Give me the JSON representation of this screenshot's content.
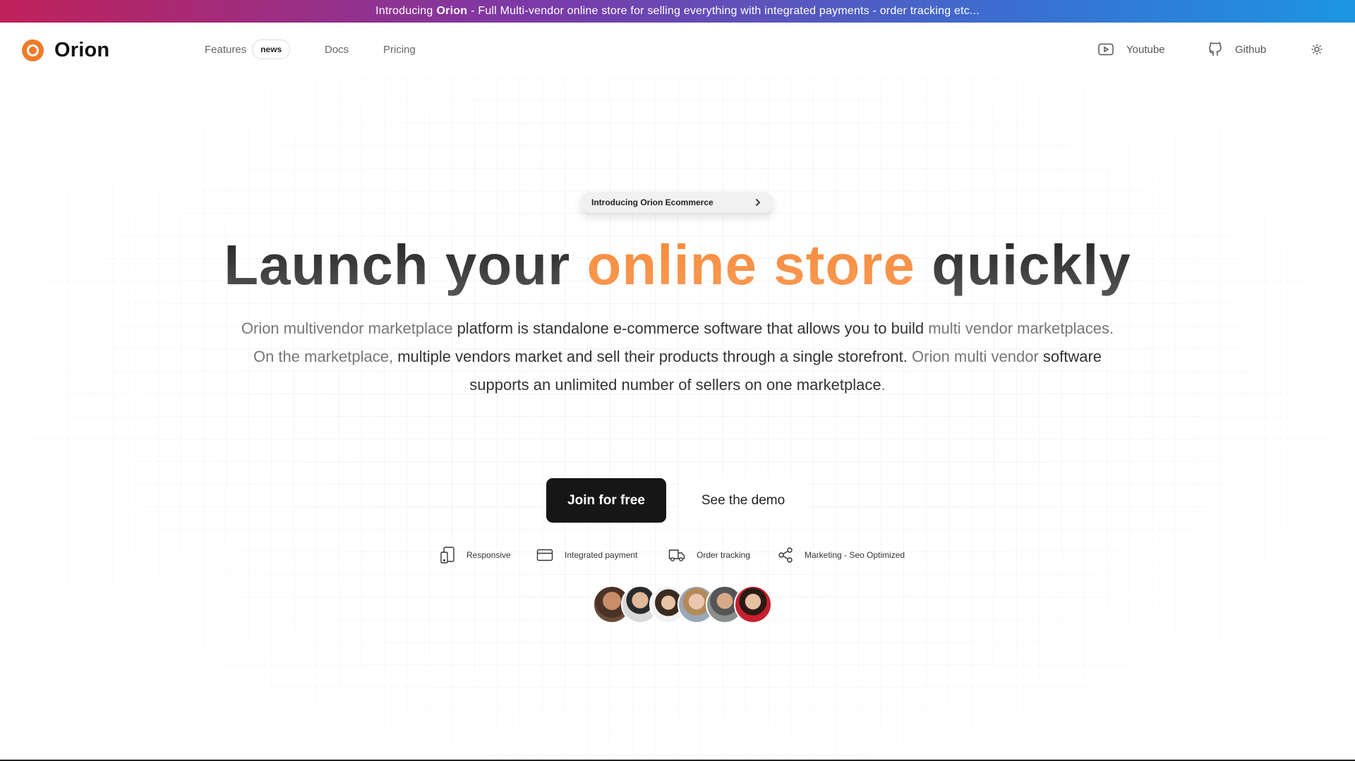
{
  "banner": {
    "prefix": "Introducing",
    "brand": "Orion",
    "suffix": "- Full Multi-vendor online store for selling everything with integrated payments - order tracking etc..."
  },
  "header": {
    "logo_text": "Orion",
    "nav": {
      "features": "Features",
      "features_badge": "news",
      "docs": "Docs",
      "pricing": "Pricing"
    },
    "right": {
      "youtube": "Youtube",
      "github": "Github",
      "theme_icon": "sun-icon"
    }
  },
  "hero": {
    "pill_label": "Introducing Orion Ecommerce",
    "headline": {
      "part1": "Launch your ",
      "highlight": "online store",
      "part2": " quickly"
    },
    "subtitle": {
      "a": "Orion multivendor marketplace",
      "b": " platform is standalone e-commerce software that allows you to build",
      "c": " multi vendor marketplaces. On the marketplace,",
      "d": " multiple vendors market and sell their products through a single storefront.",
      "e": " Orion multi vendor",
      "f": " software supports an unlimited number of sellers on one marketplace",
      "g": "."
    },
    "cta_primary": "Join for free",
    "cta_secondary": "See the demo"
  },
  "features": [
    {
      "label": "Responsive",
      "icon": "device-icon"
    },
    {
      "label": "Integrated payment",
      "icon": "credit-card-icon"
    },
    {
      "label": "Order tracking",
      "icon": "truck-icon"
    },
    {
      "label": "Marketing - Seo Optimized",
      "icon": "share-icon"
    }
  ],
  "colors": {
    "accent": "#f58a3a",
    "button_dark": "#161616",
    "banner_start": "#c0225a",
    "banner_end": "#1c96e0"
  }
}
